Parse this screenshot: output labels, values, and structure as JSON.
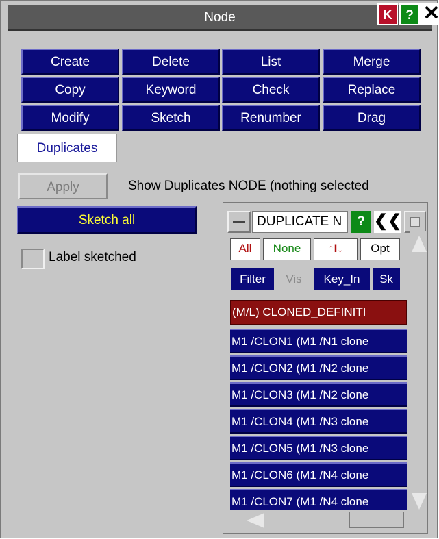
{
  "window": {
    "title": "Node",
    "k_label": "K",
    "help_label": "?",
    "close_label": "✕"
  },
  "buttons": [
    [
      "Create",
      "Delete",
      "List",
      "Merge"
    ],
    [
      "Copy",
      "Keyword",
      "Check",
      "Replace"
    ],
    [
      "Modify",
      "Sketch",
      "Renumber",
      "Drag"
    ]
  ],
  "active_tab": "Duplicates",
  "apply_label": "Apply",
  "status_text": "Show Duplicates NODE (nothing selected",
  "sketch_all_label": "Sketch all",
  "label_sketched": {
    "label": "Label sketched",
    "checked": false
  },
  "subwindow": {
    "title": "DUPLICATE N",
    "help_label": "?",
    "collapse_label": "❮❮",
    "all_label": "All",
    "none_label": "None",
    "sort_label": "↑I↓",
    "opt_label": "Opt",
    "filter_label": "Filter",
    "vis_label": "Vis",
    "keyin_label": "Key_In",
    "sk_label": "Sk",
    "header_row": "(M/L) CLONED_DEFINITI",
    "rows": [
      "M1 /CLON1 (M1 /N1 clone",
      "M1 /CLON2 (M1 /N2 clone",
      "M1 /CLON3 (M1 /N2 clone",
      "M1 /CLON4 (M1 /N3 clone",
      "M1 /CLON5 (M1 /N3 clone",
      "M1 /CLON6 (M1 /N4 clone",
      "M1 /CLON7 (M1 /N4 clone"
    ]
  },
  "colors": {
    "panel_bg": "#c6c6c6",
    "button_blue": "#0a0a7a",
    "header_red": "#8a1010",
    "sketch_text_yellow": "#ffff33",
    "help_green": "#0d8a17",
    "k_red": "#b8102a"
  }
}
